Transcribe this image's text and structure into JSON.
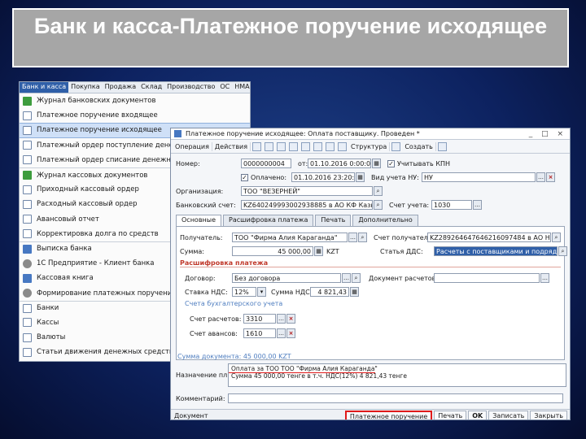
{
  "slide": {
    "title": "Банк и касса-Платежное поручение исходящее"
  },
  "menu": {
    "bar": [
      "Банк и касса",
      "Покупка",
      "Продажа",
      "Склад",
      "Производство",
      "ОС",
      "НМА",
      "З"
    ],
    "items": [
      "Журнал банковских документов",
      "Платежное поручение входящее",
      "Платежное поручение исходящее",
      "Платежный ордер поступление денежных",
      "Платежный ордер списание денежных сре",
      "Журнал кассовых документов",
      "Приходный кассовый ордер",
      "Расходный кассовый ордер",
      "Авансовый отчет",
      "Корректировка долга по средств",
      "Выписка банка",
      "1С Предприятие - Клиент банка",
      "Кассовая книга",
      "Формирование платежных поручений на",
      "Банки",
      "Кассы",
      "Валюты",
      "Статьи движения денежных средств"
    ]
  },
  "doc": {
    "title": "Платежное поручение исходящее: Оплата поставщику. Проведен *",
    "window_controls": "_ □ ×",
    "toolbar": {
      "operation": "Операция",
      "actions": "Действия",
      "structure": "Структура",
      "print": "Создать"
    },
    "fields": {
      "number_label": "Номер:",
      "number_value": "0000000004",
      "from_label": "от:",
      "date_value": "01.10.2016 0:00:00",
      "take_kpn_label": "Учитывать КПН",
      "paid_label": "Оплачено:",
      "paid_date": "01.10.2016 23:20:54",
      "nu_label": "Вид учета НУ:",
      "nu_value": "НУ",
      "org_label": "Организация:",
      "org_value": "ТОО \"ВЕЗЕРНЕЙ\"",
      "bank_account_label": "Банковский счет:",
      "bank_account_value": "KZ640249993002938885 в АО КФ Казкоммерцбанк",
      "bill_label": "Счет учета:",
      "bill_value": "1030"
    },
    "tabs": [
      "Основные",
      "Расшифровка платежа",
      "Печать",
      "Дополнительно"
    ],
    "main": {
      "recipient_label": "Получатель:",
      "recipient_value": "ТОО \"Фирма Алия Караганда\"",
      "recipient_account_label": "Счет получателя:",
      "recipient_account_value": "KZ289264647646216097484 в АО Народный",
      "sum_label": "Сумма:",
      "sum_value": "45 000,00",
      "currency": "KZT",
      "dds_label": "Статья ДДС:",
      "dds_value": "Расчеты с поставщиками и подрядчиками",
      "section_payment": "Расшифровка платежа",
      "contract_label": "Договор:",
      "contract_value": "Без договора",
      "settlement_doc_label": "Документ расчетов:",
      "vat_rate_label": "Ставка НДС:",
      "vat_rate_value": "12%",
      "vat_sum_label": "Сумма НДС:",
      "vat_sum_value": "4 821,43",
      "section_accounts": "Счета бухгалтерского учета",
      "settlement_account_label": "Счет расчетов:",
      "settlement_account_value": "3310",
      "advance_account_label": "Счет авансов:",
      "advance_account_value": "1610"
    },
    "total_text": "Сумма документа: 45 000,00 KZT",
    "payment_purpose_label": "Назначение пл.:",
    "payment_purpose_line1": "Оплата за ТОО ТОО \"Фирма Алия Караганда\"",
    "payment_purpose_line2": "Сумма 45 000,00 тенге в т.ч. НДС(12%) 4 821,43 тенге",
    "comment_label": "Комментарий:",
    "footer": {
      "print_form": "Платежное поручение",
      "print": "Печать",
      "ok": "OK",
      "write": "Записать",
      "close": "Закрыть",
      "left_link": "Документ"
    }
  }
}
